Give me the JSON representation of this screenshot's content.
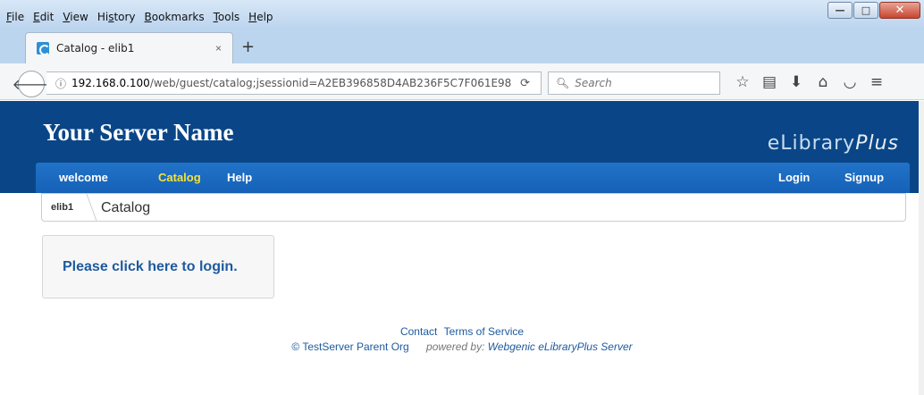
{
  "menu": [
    "File",
    "Edit",
    "View",
    "History",
    "Bookmarks",
    "Tools",
    "Help"
  ],
  "menu_underline": [
    "F",
    "E",
    "V",
    "s",
    "B",
    "T",
    "H"
  ],
  "tab": {
    "title": "Catalog - elib1",
    "close": "×"
  },
  "newtab": "+",
  "urlbar": {
    "host": "192.168.0.100",
    "path": "/web/guest/catalog;jsessionid=A2EB396858D4AB236F5C7F061E98"
  },
  "search": {
    "placeholder": "Search"
  },
  "site": {
    "name": "Your Server Name",
    "logo_main": "eLibrary",
    "logo_plus": "Plus"
  },
  "nav": {
    "welcome": "welcome",
    "catalog": "Catalog",
    "help": "Help",
    "login": "Login",
    "signup": "Signup"
  },
  "breadcrumb": {
    "home": "elib1",
    "current": "Catalog"
  },
  "login_prompt": "Please click here to login.",
  "footer": {
    "contact": "Contact",
    "terms": "Terms of Service",
    "copyright": "© TestServer Parent Org",
    "powered_prefix": "powered by:",
    "powered_link": "Webgenic eLibraryPlus Server"
  }
}
